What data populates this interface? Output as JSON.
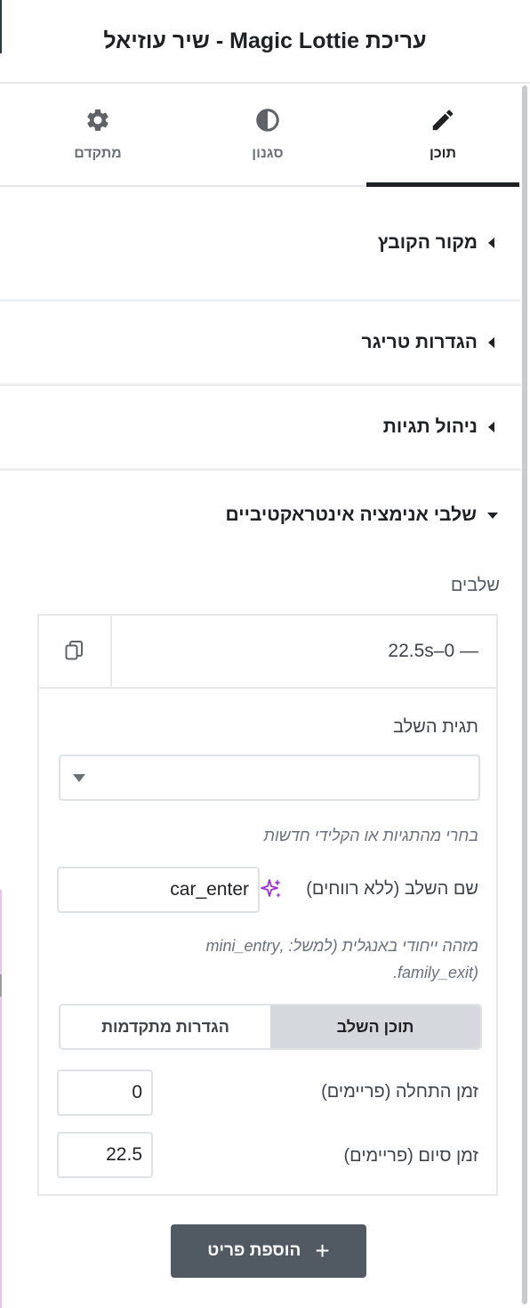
{
  "header": {
    "title": "עריכת Magic Lottie - שיר עוזיאל"
  },
  "tabs": [
    {
      "label": "תוכן",
      "icon": "pencil-icon",
      "active": true
    },
    {
      "label": "סגנון",
      "icon": "contrast-icon",
      "active": false
    },
    {
      "label": "מתקדם",
      "icon": "gear-icon",
      "active": false
    }
  ],
  "sections": [
    {
      "title": "מקור הקובץ",
      "expanded": false
    },
    {
      "title": "הגדרות טריגר",
      "expanded": false
    },
    {
      "title": "ניהול תגיות",
      "expanded": false
    },
    {
      "title": "שלבי אנימציה אינטראקטיביים",
      "expanded": true
    }
  ],
  "steps": {
    "label": "שלבים",
    "item": {
      "title": "22.5s–0 —",
      "copy_icon": "copy-icon",
      "tag_label": "תגית השלב",
      "tag_value": "",
      "tag_help": "בחרי מהתגיות או הקלידי חדשות",
      "name_label": "שם השלב (ללא רווחים)",
      "name_value": "car_enter",
      "ai_icon": "sparkle-icon",
      "name_help_line1": "מזהה ייחודי באנגלית (למשל: ,mini_entry",
      "name_help_line2": "(family_exit.",
      "switch_content": "תוכן השלב",
      "switch_advanced": "הגדרות מתקדמות",
      "start_label": "זמן התחלה (פריימים)",
      "start_value": "0",
      "end_label": "זמן סיום (פריימים)",
      "end_value": "22.5"
    }
  },
  "add_button": {
    "label": "הוספת פריט",
    "icon": "plus-icon"
  },
  "colors": {
    "accent": "#1f2124",
    "button_bg": "#515962",
    "ai_accent": "#9b2fd6"
  }
}
